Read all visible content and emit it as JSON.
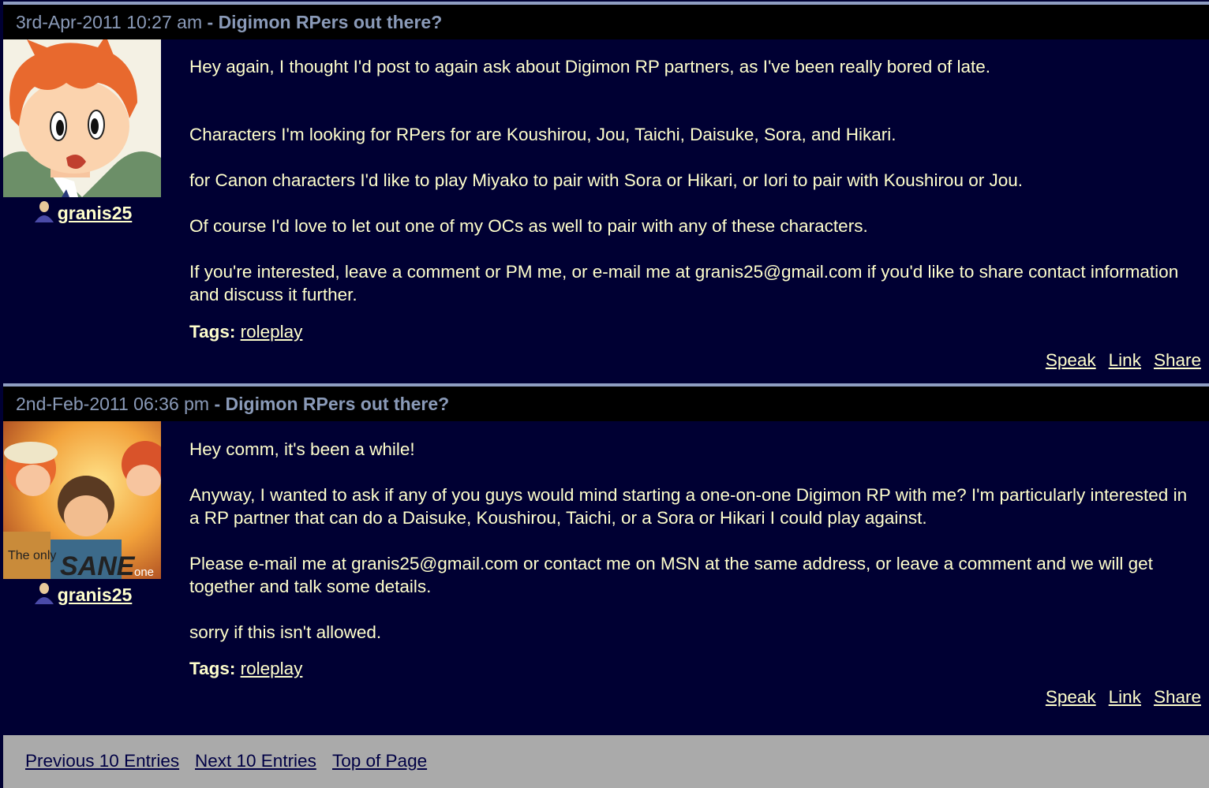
{
  "entries": [
    {
      "date": "3rd-Apr-2011 10:27 am",
      "separator": " - ",
      "subject": "Digimon RPers out there?",
      "username": "granis25",
      "paragraphs": [
        "Hey again, I thought I'd post to again ask about Digimon RP partners, as I've been really bored of late.",
        "Characters I'm looking for RPers for are Koushirou, Jou, Taichi, Daisuke, Sora, and Hikari.",
        "for Canon characters I'd like to play Miyako to pair with Sora or Hikari, or Iori to pair with Koushirou or Jou.",
        "Of course I'd love to let out one of my OCs as well to pair with any of these characters.",
        "If you're interested, leave a comment or PM me, or e-mail me at granis25@gmail.com if you'd like to share contact information and discuss it further."
      ],
      "tags_label": "Tags:",
      "tag": "roleplay",
      "actions": {
        "speak": "Speak",
        "link": "Link",
        "share": "Share"
      }
    },
    {
      "date": "2nd-Feb-2011 06:36 pm",
      "separator": " - ",
      "subject": "Digimon RPers out there?",
      "username": "granis25",
      "avatar_text": {
        "prefix": "The only",
        "main": "SANE",
        "suffix": "one"
      },
      "paragraphs": [
        "Hey comm, it's been a while!",
        "Anyway, I wanted to ask if any of you guys would mind starting a one-on-one Digimon RP with me? I'm particularly interested in a RP partner that can do a Daisuke, Koushirou, Taichi, or a Sora or Hikari I could play against.",
        "Please e-mail me at granis25@gmail.com or contact me on MSN at the same address, or leave a comment and we will get together and talk some details.",
        "sorry if this isn't allowed."
      ],
      "tags_label": "Tags:",
      "tag": "roleplay",
      "actions": {
        "speak": "Speak",
        "link": "Link",
        "share": "Share"
      }
    }
  ],
  "footer": {
    "previous": "Previous 10 Entries",
    "next": "Next 10 Entries",
    "top": "Top of Page"
  },
  "colors": {
    "background": "#000033",
    "header_background": "#000000",
    "header_text": "#8a9ab8",
    "body_text": "#ffffcc",
    "footer_background": "#aaaaaa",
    "footer_link": "#000044"
  }
}
